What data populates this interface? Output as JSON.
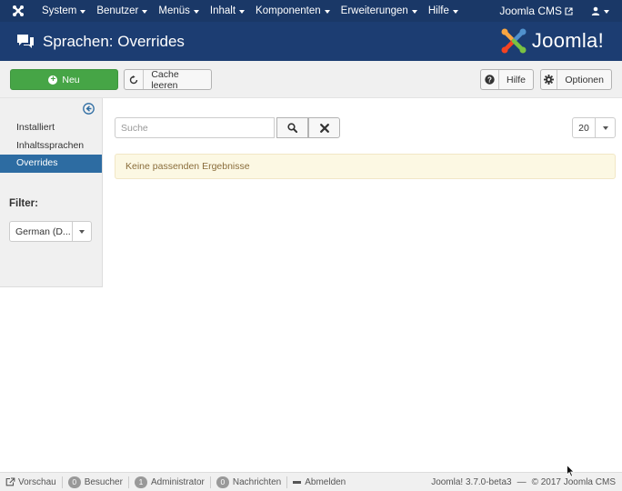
{
  "topnav": {
    "menu": [
      {
        "label": "System"
      },
      {
        "label": "Benutzer"
      },
      {
        "label": "Menüs"
      },
      {
        "label": "Inhalt"
      },
      {
        "label": "Komponenten"
      },
      {
        "label": "Erweiterungen"
      },
      {
        "label": "Hilfe"
      }
    ],
    "site_label": "Joomla CMS"
  },
  "header": {
    "title": "Sprachen: Overrides",
    "brand": "Joomla!",
    "brand_color": "#1c3d72"
  },
  "toolbar": {
    "new_label": "Neu",
    "cache_label": "Cache leeren",
    "help_label": "Hilfe",
    "options_label": "Optionen",
    "new_color": "#46a546"
  },
  "sidebar": {
    "items": [
      {
        "label": "Installiert",
        "active": false
      },
      {
        "label": "Inhaltssprachen",
        "active": false
      },
      {
        "label": "Overrides",
        "active": true
      }
    ],
    "filter_label": "Filter:",
    "filter_value": "German (D..."
  },
  "main": {
    "search_placeholder": "Suche",
    "limit_value": "20",
    "alert_text": "Keine passenden Ergebnisse"
  },
  "footer": {
    "preview": "Vorschau",
    "visitors_count": "0",
    "visitors_label": "Besucher",
    "admins_count": "1",
    "admins_label": "Administrator",
    "messages_count": "0",
    "messages_label": "Nachrichten",
    "logout": "Abmelden",
    "version": "Joomla! 3.7.0-beta3",
    "dash": "—",
    "copyright": "© 2017 Joomla CMS"
  }
}
